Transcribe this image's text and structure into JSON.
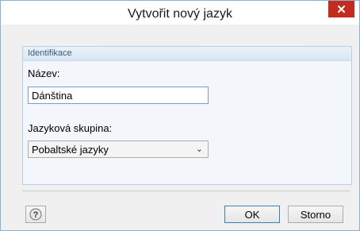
{
  "window": {
    "title": "Vytvořit nový jazyk",
    "close_glyph": "✕"
  },
  "group": {
    "title": "Identifikace",
    "name_label": "Název:",
    "name_value": "Dánština",
    "language_group_label": "Jazyková skupina:",
    "language_group_value": "Pobaltské jazyky",
    "chevron_glyph": "⌄"
  },
  "buttons": {
    "help_glyph": "?",
    "ok_label": "OK",
    "cancel_label": "Storno"
  },
  "colors": {
    "close_button": "#c42b1c",
    "group_border": "#b9cfe2",
    "group_title": "#3a5a80"
  },
  "icons": [
    "close-icon",
    "chevron-down-icon",
    "help-icon"
  ]
}
